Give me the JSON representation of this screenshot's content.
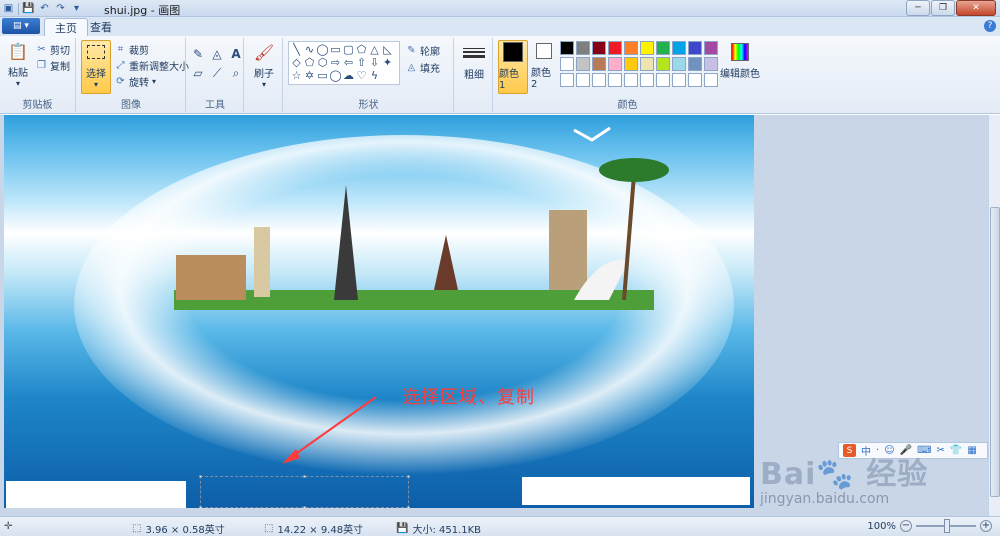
{
  "window": {
    "title": "shui.jpg - 画图",
    "controls": {
      "minimize": "─",
      "maximize": "❐",
      "close": "✕"
    }
  },
  "quick_access": {
    "icons": [
      "paint-app-icon",
      "save-icon",
      "undo-icon",
      "redo-icon",
      "customize-icon"
    ]
  },
  "tabs": {
    "home": "主页",
    "view": "查看"
  },
  "app_menu": "▤ ▾",
  "help": "?",
  "ribbon": {
    "clipboard": {
      "paste": "粘贴",
      "cut": "剪切",
      "copy": "复制",
      "group": "剪贴板"
    },
    "image": {
      "select": "选择",
      "crop": "裁剪",
      "resize": "重新调整大小",
      "rotate": "旋转",
      "group": "图像"
    },
    "tools": {
      "group": "工具"
    },
    "brush": {
      "label": "刷子"
    },
    "shapes": {
      "outline": "轮廓",
      "fill": "填充",
      "group": "形状"
    },
    "size": {
      "label": "粗细"
    },
    "colors": {
      "color1": "颜色 1",
      "color2": "颜色 2",
      "edit": "编辑颜色",
      "group": "颜色",
      "color1_value": "#000000",
      "color2_value": "#ffffff",
      "palette": [
        "#000000",
        "#7f7f7f",
        "#880015",
        "#ed1c24",
        "#ff7f27",
        "#fff200",
        "#22b14c",
        "#00a2e8",
        "#3f48cc",
        "#a349a4",
        "#ffffff",
        "#c3c3c3",
        "#b97a57",
        "#ffaec9",
        "#ffc90e",
        "#efe4b0",
        "#b5e61d",
        "#99d9ea",
        "#7092be",
        "#c8bfe7",
        "#ffffff",
        "#ffffff",
        "#ffffff",
        "#ffffff",
        "#ffffff",
        "#ffffff",
        "#ffffff",
        "#ffffff",
        "#ffffff",
        "#ffffff"
      ]
    }
  },
  "canvas": {
    "annotation": "选择区域、复制",
    "annotation_color": "#ff3b3b"
  },
  "ime": {
    "logo": "S",
    "items": [
      "中",
      "·",
      "☺",
      "🎤",
      "⌨",
      "✂",
      "👕",
      "▦"
    ]
  },
  "watermark": {
    "brand": "Bai🐾 经验",
    "url": "jingyan.baidu.com"
  },
  "status": {
    "selection_size": "3.96 × 0.58英寸",
    "image_size": "14.22 × 9.48英寸",
    "file_size": "大小: 451.1KB",
    "zoom": "100%"
  }
}
